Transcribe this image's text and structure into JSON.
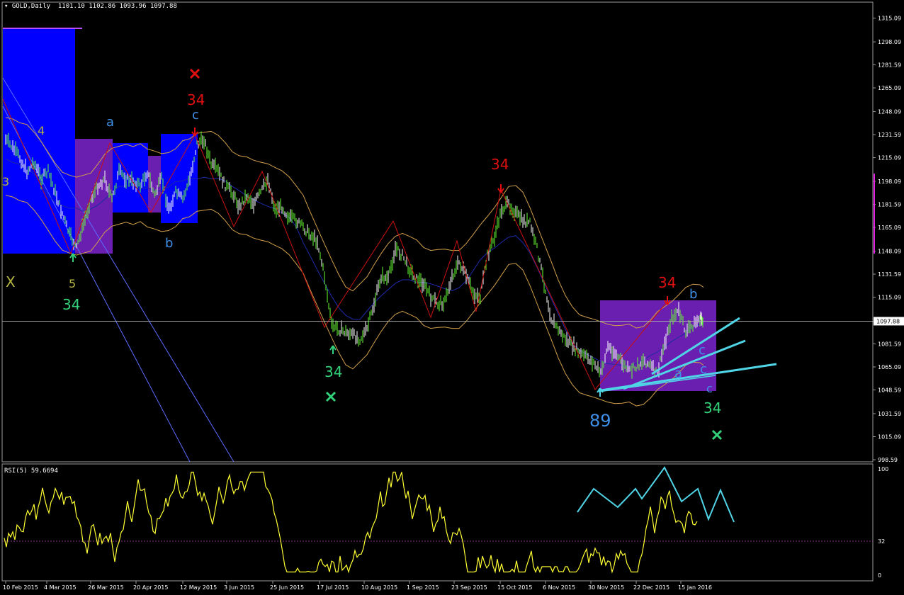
{
  "window": {
    "symbol": "GOLD,Daily",
    "ohlc": {
      "open": "1101.10",
      "high": "1102.86",
      "low": "1093.96",
      "close": "1097.88"
    }
  },
  "rsi": {
    "label": "RSI(5) 59.6694",
    "levels": [
      "100",
      "32",
      "0"
    ]
  },
  "colors": {
    "background": "#000000",
    "candle_up": "#66ff33",
    "candle_down": "#ffffff",
    "box_blue": "#0000ff",
    "box_purple": "#6a1fb0",
    "bollinger": "#d2a04a",
    "ma": "#1e2aa8",
    "zigzag": "#cc1111",
    "fan": "#4fd5e6",
    "rsi": "#ffff33",
    "wave_red": "#e01010",
    "wave_blue": "#3f8fe8",
    "wave_green": "#33d17a",
    "wave_olive": "#b5b542"
  },
  "chart_data": {
    "type": "candlestick",
    "title": "GOLD,Daily",
    "price_axis": [
      "1315.09",
      "1298.09",
      "1281.59",
      "1265.09",
      "1248.09",
      "1231.59",
      "1215.09",
      "1198.09",
      "1181.59",
      "1165.09",
      "1148.09",
      "1131.59",
      "1115.09",
      "1097.88",
      "1081.59",
      "1065.09",
      "1048.59",
      "1031.59",
      "1015.09",
      "998.59"
    ],
    "current_price": "1097.88",
    "ylim": [
      998.59,
      1322
    ],
    "date_axis": [
      "10 Feb 2015",
      "4 Mar 2015",
      "26 Mar 2015",
      "20 Apr 2015",
      "12 May 2015",
      "3 Jun 2015",
      "25 Jun 2015",
      "17 Jul 2015",
      "10 Aug 2015",
      "1 Sep 2015",
      "23 Sep 2015",
      "15 Oct 2015",
      "6 Nov 2015",
      "30 Nov 2015",
      "22 Dec 2015",
      "15 Jan 2016"
    ],
    "close_path": [
      [
        0,
        1228
      ],
      [
        10,
        1222
      ],
      [
        20,
        1215
      ],
      [
        30,
        1205
      ],
      [
        40,
        1212
      ],
      [
        50,
        1200
      ],
      [
        60,
        1205
      ],
      [
        70,
        1190
      ],
      [
        80,
        1175
      ],
      [
        90,
        1160
      ],
      [
        100,
        1150
      ],
      [
        110,
        1168
      ],
      [
        120,
        1185
      ],
      [
        130,
        1195
      ],
      [
        140,
        1200
      ],
      [
        150,
        1185
      ],
      [
        160,
        1205
      ],
      [
        170,
        1200
      ],
      [
        180,
        1198
      ],
      [
        190,
        1195
      ],
      [
        200,
        1205
      ],
      [
        210,
        1188
      ],
      [
        220,
        1200
      ],
      [
        230,
        1178
      ],
      [
        240,
        1190
      ],
      [
        250,
        1185
      ],
      [
        260,
        1200
      ],
      [
        270,
        1225
      ],
      [
        280,
        1228
      ],
      [
        290,
        1210
      ],
      [
        300,
        1205
      ],
      [
        310,
        1195
      ],
      [
        320,
        1190
      ],
      [
        330,
        1180
      ],
      [
        340,
        1188
      ],
      [
        350,
        1182
      ],
      [
        360,
        1190
      ],
      [
        370,
        1200
      ],
      [
        380,
        1178
      ],
      [
        390,
        1180
      ],
      [
        400,
        1172
      ],
      [
        410,
        1170
      ],
      [
        420,
        1165
      ],
      [
        430,
        1160
      ],
      [
        440,
        1155
      ],
      [
        450,
        1130
      ],
      [
        460,
        1095
      ],
      [
        470,
        1092
      ],
      [
        480,
        1090
      ],
      [
        490,
        1088
      ],
      [
        500,
        1085
      ],
      [
        510,
        1092
      ],
      [
        520,
        1110
      ],
      [
        530,
        1130
      ],
      [
        540,
        1128
      ],
      [
        550,
        1150
      ],
      [
        560,
        1145
      ],
      [
        570,
        1135
      ],
      [
        580,
        1128
      ],
      [
        590,
        1125
      ],
      [
        600,
        1115
      ],
      [
        610,
        1110
      ],
      [
        620,
        1112
      ],
      [
        630,
        1130
      ],
      [
        640,
        1140
      ],
      [
        650,
        1130
      ],
      [
        660,
        1118
      ],
      [
        670,
        1115
      ],
      [
        680,
        1145
      ],
      [
        690,
        1158
      ],
      [
        700,
        1178
      ],
      [
        710,
        1182
      ],
      [
        720,
        1175
      ],
      [
        730,
        1170
      ],
      [
        740,
        1168
      ],
      [
        750,
        1150
      ],
      [
        760,
        1125
      ],
      [
        770,
        1100
      ],
      [
        780,
        1092
      ],
      [
        790,
        1085
      ],
      [
        800,
        1080
      ],
      [
        810,
        1075
      ],
      [
        820,
        1072
      ],
      [
        830,
        1068
      ],
      [
        840,
        1060
      ],
      [
        850,
        1080
      ],
      [
        860,
        1075
      ],
      [
        870,
        1068
      ],
      [
        880,
        1062
      ],
      [
        890,
        1065
      ],
      [
        900,
        1070
      ],
      [
        910,
        1066
      ],
      [
        920,
        1060
      ],
      [
        930,
        1082
      ],
      [
        940,
        1100
      ],
      [
        950,
        1105
      ],
      [
        960,
        1090
      ],
      [
        970,
        1095
      ],
      [
        980,
        1100
      ],
      [
        985,
        1098
      ]
    ],
    "wave_labels": [
      {
        "text": "3",
        "color": "wave_olive",
        "size": 16
      },
      {
        "text": "4",
        "color": "wave_olive",
        "size": 16
      },
      {
        "text": "X",
        "color": "wave_olive",
        "size": 20
      },
      {
        "text": "5",
        "color": "wave_olive",
        "size": 16
      },
      {
        "text": "34",
        "color": "wave_green",
        "size": 20
      },
      {
        "text": "a",
        "color": "wave_blue",
        "size": 18
      },
      {
        "text": "b",
        "color": "wave_blue",
        "size": 18
      },
      {
        "text": "34",
        "color": "wave_red",
        "size": 20
      },
      {
        "text": "c",
        "color": "wave_blue",
        "size": 18
      },
      {
        "text": "34",
        "color": "wave_green",
        "size": 20
      },
      {
        "text": "34",
        "color": "wave_red",
        "size": 20
      },
      {
        "text": "34",
        "color": "wave_red",
        "size": 20
      },
      {
        "text": "b",
        "color": "wave_blue",
        "size": 18
      },
      {
        "text": "c",
        "color": "wave_blue",
        "size": 18
      },
      {
        "text": "a",
        "color": "wave_blue",
        "size": 18
      },
      {
        "text": "c",
        "color": "wave_blue",
        "size": 18
      },
      {
        "text": "c",
        "color": "wave_blue",
        "size": 16
      },
      {
        "text": "89",
        "color": "wave_blue",
        "size": 24
      },
      {
        "text": "34",
        "color": "wave_green",
        "size": 20
      }
    ]
  }
}
